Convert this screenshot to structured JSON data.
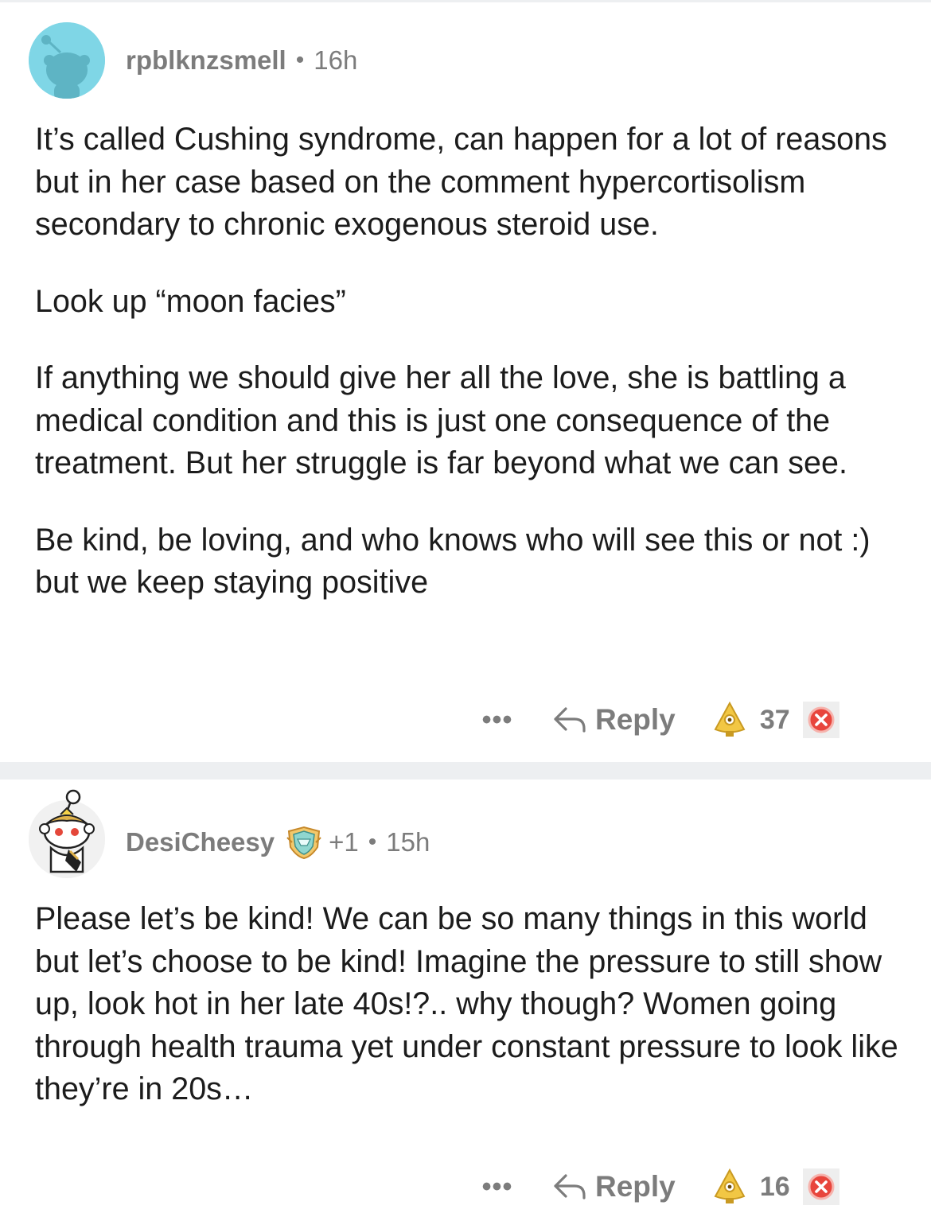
{
  "comments": [
    {
      "username": "rpblknzsmell",
      "time": "16h",
      "paragraphs": [
        "It’s called Cushing syndrome, can happen for a lot of reasons but in her case based on the comment hypercortisolism secondary to chronic exogenous steroid use.",
        "Look up “moon facies”",
        "If anything we should give her all the love, she is battling a medical condition and this is just one consequence of the treatment. But her struggle is far beyond what we can see.",
        "Be kind, be loving, and who knows who will see this or not :) but we keep staying positive"
      ],
      "more_label": "•••",
      "reply_label": "Reply",
      "score": "37"
    },
    {
      "username": "DesiCheesy",
      "karma": "+1",
      "time": "15h",
      "paragraphs": [
        "Please let’s be kind! We can be so many things in this world but let’s choose to be kind! Imagine the pressure to still show up, look hot in her late 40s!?.. why though? Women going through health trauma yet under constant pressure to look like they’re in 20s…"
      ],
      "more_label": "•••",
      "reply_label": "Reply",
      "score": "16"
    }
  ],
  "colors": {
    "text": "#1c1c1c",
    "meta": "#7c7c7c",
    "avatar1_bg": "#7fd6e6",
    "upvote": "#f2c744",
    "downvote": "#e8453c",
    "divider": "#edeff1"
  },
  "icons": {
    "avatar1": "snoo-avatar-icon",
    "avatar2": "snoo-costume-avatar-icon",
    "flair": "achievement-badge-icon",
    "reply": "reply-arrow-icon",
    "upvote": "upvote-award-icon",
    "downvote": "downvote-icon"
  }
}
